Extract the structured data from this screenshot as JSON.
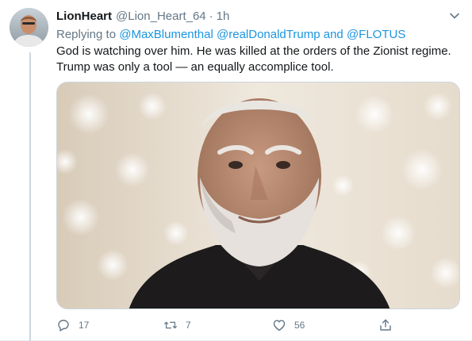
{
  "tweet": {
    "display_name": "LionHeart",
    "handle": "@Lion_Heart_64",
    "separator": "·",
    "time": "1h",
    "replying_prefix": "Replying to",
    "replying_to": [
      "@MaxBlumenthal",
      "@realDonaldTrump"
    ],
    "replying_and": "and",
    "replying_last": "@FLOTUS",
    "text": "God is watching over him. He was killed at the orders of the Zionist regime. Trump was only a tool — an equally accomplice tool.",
    "actions": {
      "reply_count": "17",
      "retweet_count": "7",
      "like_count": "56",
      "share_count": ""
    }
  },
  "colors": {
    "link": "#1b95e0",
    "secondary_text": "#657786",
    "primary_text": "#14171a",
    "border": "#e6ecf0"
  },
  "icons": {
    "caret": "chevron-down-icon",
    "reply": "reply-icon",
    "retweet": "retweet-icon",
    "like": "heart-icon",
    "share": "share-icon"
  }
}
